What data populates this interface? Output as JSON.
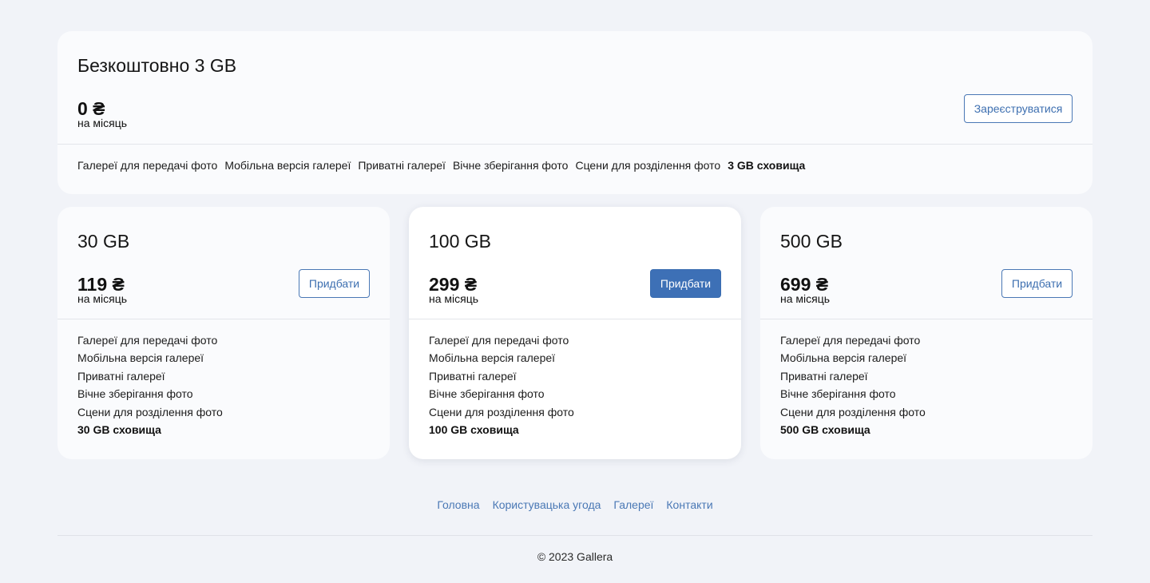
{
  "free_plan": {
    "title": "Безкоштовно 3 GB",
    "price": "0 ₴",
    "period": "на місяць",
    "button_label": "Зареєструватися",
    "features": [
      "Галереї для передачі фото",
      "Мобільна версія галереї",
      "Приватні галереї",
      "Вічне зберігання фото",
      "Сцени для розділення фото"
    ],
    "storage": "3 GB сховища"
  },
  "plans": [
    {
      "title": "30 GB",
      "price": "119 ₴",
      "period": "на місяць",
      "button_label": "Придбати",
      "features": [
        "Галереї для передачі фото",
        "Мобільна версія галереї",
        "Приватні галереї",
        "Вічне зберігання фото",
        "Сцени для розділення фото"
      ],
      "storage": "30 GB сховища"
    },
    {
      "title": "100 GB",
      "price": "299 ₴",
      "period": "на місяць",
      "button_label": "Придбати",
      "features": [
        "Галереї для передачі фото",
        "Мобільна версія галереї",
        "Приватні галереї",
        "Вічне зберігання фото",
        "Сцени для розділення фото"
      ],
      "storage": "100 GB сховища"
    },
    {
      "title": "500 GB",
      "price": "699 ₴",
      "period": "на місяць",
      "button_label": "Придбати",
      "features": [
        "Галереї для передачі фото",
        "Мобільна версія галереї",
        "Приватні галереї",
        "Вічне зберігання фото",
        "Сцени для розділення фото"
      ],
      "storage": "500 GB сховища"
    }
  ],
  "footer": {
    "links": [
      "Головна",
      "Користувацька угода",
      "Галереї",
      "Контакти"
    ],
    "copyright": "© 2023 Gallera"
  },
  "colors": {
    "page_background": "#f1f3f8",
    "card_background": "#fafbfd",
    "accent": "#3d70b6",
    "link": "#4a78b5"
  }
}
